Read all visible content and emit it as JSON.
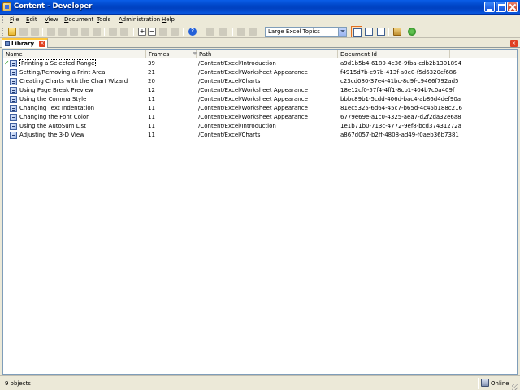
{
  "window": {
    "title": "Content - Developer"
  },
  "menu": {
    "items": [
      "File",
      "Edit",
      "View",
      "Document",
      "Tools",
      "Administration",
      "Help"
    ]
  },
  "toolbar": {
    "view_combo_value": "Large Excel Topics"
  },
  "tabs": {
    "library_label": "Library"
  },
  "grid": {
    "columns": [
      "Name",
      "Frames",
      "Path",
      "Document Id"
    ],
    "rows": [
      {
        "name": "Printing a Selected Range",
        "frames": "39",
        "path": "/Content/Excel/Introduction",
        "doc_id": "a9d1b5b4-6180-4c36-9fba-cdb2b1301894"
      },
      {
        "name": "Setting/Removing a Print Area",
        "frames": "21",
        "path": "/Content/Excel/Worksheet Appearance",
        "doc_id": "f4915d7b-c97b-413f-a0e0-f5d6320cf686"
      },
      {
        "name": "Creating Charts with the Chart Wizard",
        "frames": "20",
        "path": "/Content/Excel/Charts",
        "doc_id": "c23cd080-37e4-41bc-8d9f-c9466f792ad5"
      },
      {
        "name": "Using Page Break Preview",
        "frames": "12",
        "path": "/Content/Excel/Worksheet Appearance",
        "doc_id": "18e12cf0-57f4-4ff1-8cb1-404b7c0a409f"
      },
      {
        "name": "Using the Comma Style",
        "frames": "11",
        "path": "/Content/Excel/Worksheet Appearance",
        "doc_id": "bbbc89b1-5cdd-406d-bac4-ab86d4def90a"
      },
      {
        "name": "Changing Text Indentation",
        "frames": "11",
        "path": "/Content/Excel/Worksheet Appearance",
        "doc_id": "81ec5325-6d64-45c7-b65d-4c45b188c216"
      },
      {
        "name": "Changing the Font Color",
        "frames": "11",
        "path": "/Content/Excel/Worksheet Appearance",
        "doc_id": "6779e69e-a1c0-4325-aea7-d2f2da32e6a8"
      },
      {
        "name": "Using the AutoSum List",
        "frames": "11",
        "path": "/Content/Excel/Introduction",
        "doc_id": "1e1b71b0-713c-4772-9ef8-bcd37431272a"
      },
      {
        "name": "Adjusting the 3-D View",
        "frames": "11",
        "path": "/Content/Excel/Charts",
        "doc_id": "a867d057-b2ff-4808-ad49-f0aeb36b7381"
      }
    ]
  },
  "status": {
    "object_count": "9 objects",
    "connection": "Online"
  },
  "colors": {
    "titlebar": "#0046c8",
    "tab_accent": "#ffc83c",
    "check": "#2a9a20"
  }
}
